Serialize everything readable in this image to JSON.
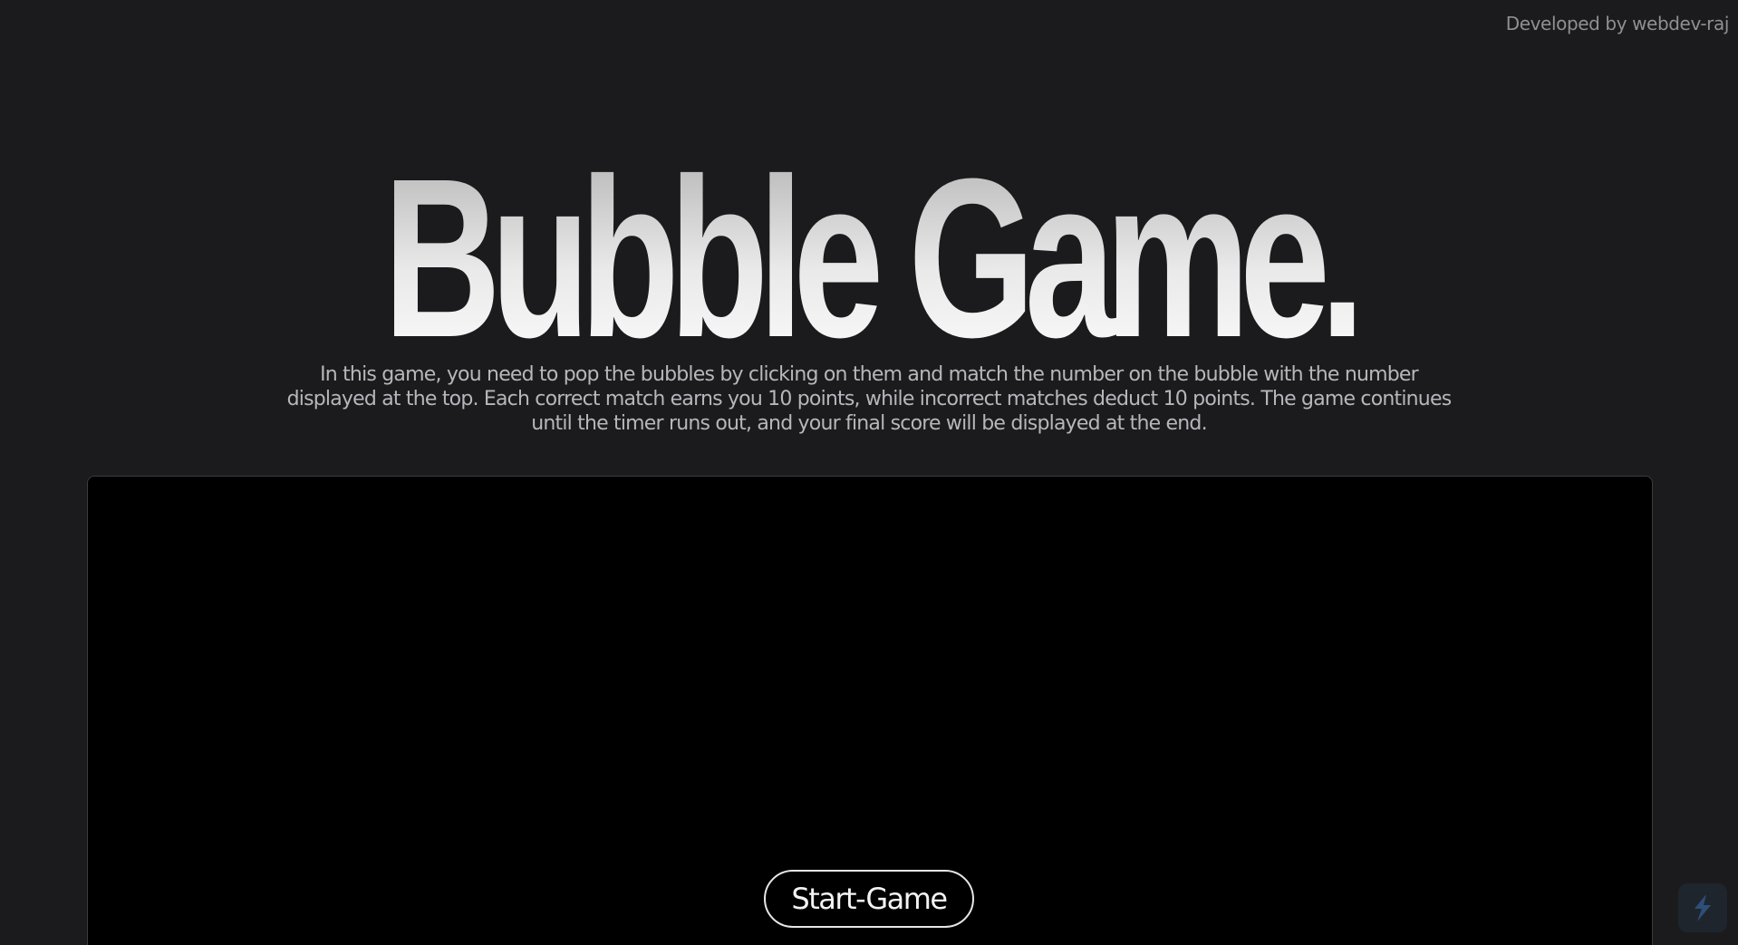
{
  "credit": {
    "text": "Developed by webdev-raj"
  },
  "hero": {
    "title": "Bubble Game.",
    "description": "In this game, you need to pop the bubbles by clicking on them and match the number on the bubble with the number displayed at the top. Each correct match earns you 10 points, while incorrect matches deduct 10 points. The game continues until the timer runs out, and your final score will be displayed at the end."
  },
  "game": {
    "start_label": "Start-Game"
  },
  "corner_widget": {
    "icon": "lightning-bolt-icon",
    "color": "#2f4f7a"
  }
}
